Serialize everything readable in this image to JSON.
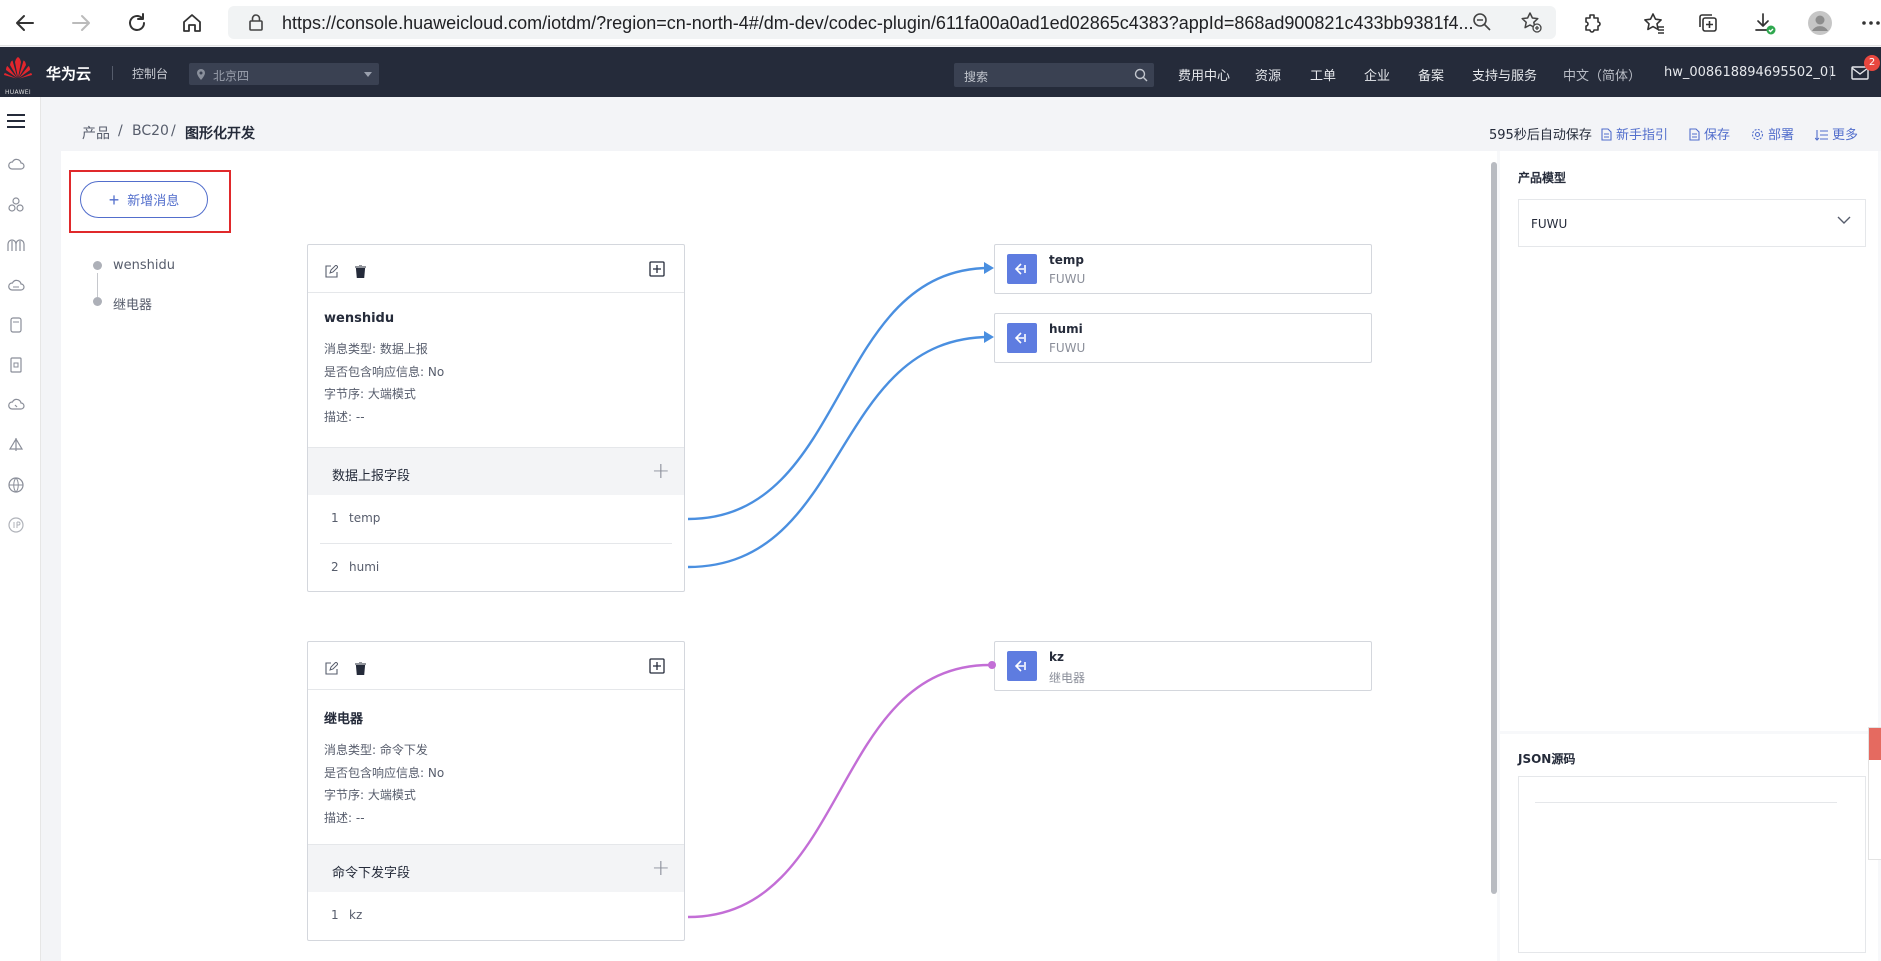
{
  "browser": {
    "url": "https://console.huaweicloud.com/iotdm/?region=cn-north-4#/dm-dev/codec-plugin/611fa00a0ad1ed02865c4383?appId=868ad900821c433bb9381f4..."
  },
  "topnav": {
    "logo_text": "HUAWEI",
    "brand": "华为云",
    "console": "控制台",
    "region": "北京四",
    "search_placeholder": "搜索",
    "items": [
      "费用中心",
      "资源",
      "工单",
      "企业",
      "备案",
      "支持与服务"
    ],
    "language": "中文（简体）",
    "username": "hw_008618894695502_01",
    "mail_count": "2"
  },
  "breadcrumb": {
    "items": [
      "产品",
      "BC20",
      "图形化开发"
    ],
    "separator": "/"
  },
  "header_actions": {
    "autosave": "595秒后自动保存",
    "guide": "新手指引",
    "save": "保存",
    "deploy": "部署",
    "more": "更多"
  },
  "canvas": {
    "add_message_label": "新增消息",
    "tree": [
      "wenshidu",
      "继电器"
    ],
    "messages": [
      {
        "name": "wenshidu",
        "type_line": "消息类型: 数据上报",
        "response_line": "是否包含响应信息: No",
        "byte_order_line": "字节序: 大端模式",
        "desc_line": "描述: --",
        "fields_title": "数据上报字段",
        "fields": [
          {
            "index": "1",
            "name": "temp"
          },
          {
            "index": "2",
            "name": "humi"
          }
        ]
      },
      {
        "name": "继电器",
        "type_line": "消息类型: 命令下发",
        "response_line": "是否包含响应信息: No",
        "byte_order_line": "字节序: 大端模式",
        "desc_line": "描述: --",
        "fields_title": "命令下发字段",
        "fields": [
          {
            "index": "1",
            "name": "kz"
          }
        ]
      }
    ],
    "properties": [
      {
        "name": "temp",
        "service": "FUWU"
      },
      {
        "name": "humi",
        "service": "FUWU"
      },
      {
        "name": "kz",
        "service": "继电器"
      }
    ]
  },
  "right_panel": {
    "model_title": "产品模型",
    "model_selected": "FUWU",
    "json_title": "JSON源码"
  },
  "colors": {
    "accent": "#526ecc",
    "property_icon": "#5e7ce0",
    "link_blue": "#4a8fe0",
    "link_purple": "#c36ed6",
    "highlight_red": "#e0292b",
    "topnav_bg": "#252b3a"
  }
}
